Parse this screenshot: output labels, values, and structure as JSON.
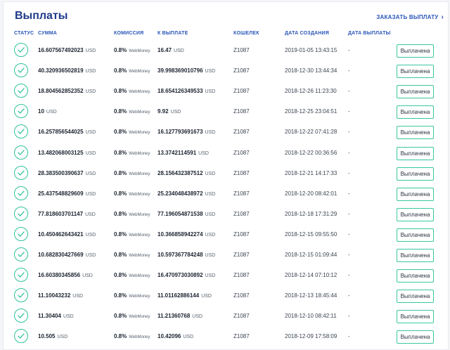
{
  "page": {
    "title": "Выплаты",
    "order_link": "ЗАКАЗАТЬ ВЫПЛАТУ",
    "accent_color": "#2a55b8",
    "status_color": "#2fc29a"
  },
  "table": {
    "headers": {
      "status": "СТАТУС",
      "sum": "СУММА",
      "commission": "КОМИССИЯ",
      "payout": "К ВЫПЛАТЕ",
      "wallet": "КОШЕЛЕК",
      "created": "ДАТА СОЗДАНИЯ",
      "paid_date": "ДАТА ВЫПЛАТЫ"
    },
    "rows": [
      {
        "sum": "16.607567492023",
        "currency": "USD",
        "commission": "0.8%",
        "commission_system": "WebMoney",
        "payout": "16.47",
        "wallet": "Z1087",
        "created": "2019-01-05 13:43:15",
        "paid_date": "-",
        "status_label": "Выплачена"
      },
      {
        "sum": "40.320936502819",
        "currency": "USD",
        "commission": "0.8%",
        "commission_system": "WebMoney",
        "payout": "39.998369010796",
        "wallet": "Z1087",
        "created": "2018-12-30 13:44:34",
        "paid_date": "-",
        "status_label": "Выплачена"
      },
      {
        "sum": "18.804562852352",
        "currency": "USD",
        "commission": "0.8%",
        "commission_system": "WebMoney",
        "payout": "18.654126349533",
        "wallet": "Z1087",
        "created": "2018-12-26 11:23:30",
        "paid_date": "-",
        "status_label": "Выплачена"
      },
      {
        "sum": "10",
        "currency": "USD",
        "commission": "0.8%",
        "commission_system": "WebMoney",
        "payout": "9.92",
        "wallet": "Z1087",
        "created": "2018-12-25 23:04:51",
        "paid_date": "-",
        "status_label": "Выплачена"
      },
      {
        "sum": "16.257856544025",
        "currency": "USD",
        "commission": "0.8%",
        "commission_system": "WebMoney",
        "payout": "16.127793691673",
        "wallet": "Z1087",
        "created": "2018-12-22 07:41:28",
        "paid_date": "-",
        "status_label": "Выплачена"
      },
      {
        "sum": "13.482068003125",
        "currency": "USD",
        "commission": "0.8%",
        "commission_system": "WebMoney",
        "payout": "13.3742114591",
        "wallet": "Z1087",
        "created": "2018-12-22 00:36:56",
        "paid_date": "-",
        "status_label": "Выплачена"
      },
      {
        "sum": "28.383500390637",
        "currency": "USD",
        "commission": "0.8%",
        "commission_system": "WebMoney",
        "payout": "28.156432387512",
        "wallet": "Z1087",
        "created": "2018-12-21 14:17:33",
        "paid_date": "-",
        "status_label": "Выплачена"
      },
      {
        "sum": "25.437548829609",
        "currency": "USD",
        "commission": "0.8%",
        "commission_system": "WebMoney",
        "payout": "25.234048438972",
        "wallet": "Z1087",
        "created": "2018-12-20 08:42:01",
        "paid_date": "-",
        "status_label": "Выплачена"
      },
      {
        "sum": "77.818603701147",
        "currency": "USD",
        "commission": "0.8%",
        "commission_system": "WebMoney",
        "payout": "77.196054871538",
        "wallet": "Z1087",
        "created": "2018-12-18 17:31:29",
        "paid_date": "-",
        "status_label": "Выплачена"
      },
      {
        "sum": "10.450462643421",
        "currency": "USD",
        "commission": "0.8%",
        "commission_system": "WebMoney",
        "payout": "10.366858942274",
        "wallet": "Z1087",
        "created": "2018-12-15 09:55:50",
        "paid_date": "-",
        "status_label": "Выплачена"
      },
      {
        "sum": "10.682830427669",
        "currency": "USD",
        "commission": "0.8%",
        "commission_system": "WebMoney",
        "payout": "10.597367784248",
        "wallet": "Z1087",
        "created": "2018-12-15 01:09:44",
        "paid_date": "-",
        "status_label": "Выплачена"
      },
      {
        "sum": "16.60380345856",
        "currency": "USD",
        "commission": "0.8%",
        "commission_system": "WebMoney",
        "payout": "16.470973030892",
        "wallet": "Z1087",
        "created": "2018-12-14 07:10:12",
        "paid_date": "-",
        "status_label": "Выплачена"
      },
      {
        "sum": "11.10043232",
        "currency": "USD",
        "commission": "0.8%",
        "commission_system": "WebMoney",
        "payout": "11.01162886144",
        "wallet": "Z1087",
        "created": "2018-12-13 18:45:44",
        "paid_date": "-",
        "status_label": "Выплачена"
      },
      {
        "sum": "11.30404",
        "currency": "USD",
        "commission": "0.8%",
        "commission_system": "WebMoney",
        "payout": "11.21360768",
        "wallet": "Z1087",
        "created": "2018-12-10 08:42:11",
        "paid_date": "-",
        "status_label": "Выплачена"
      },
      {
        "sum": "10.505",
        "currency": "USD",
        "commission": "0.8%",
        "commission_system": "WebMoney",
        "payout": "10.42096",
        "wallet": "Z1087",
        "created": "2018-12-09 17:58:09",
        "paid_date": "-",
        "status_label": "Выплачена"
      }
    ]
  }
}
